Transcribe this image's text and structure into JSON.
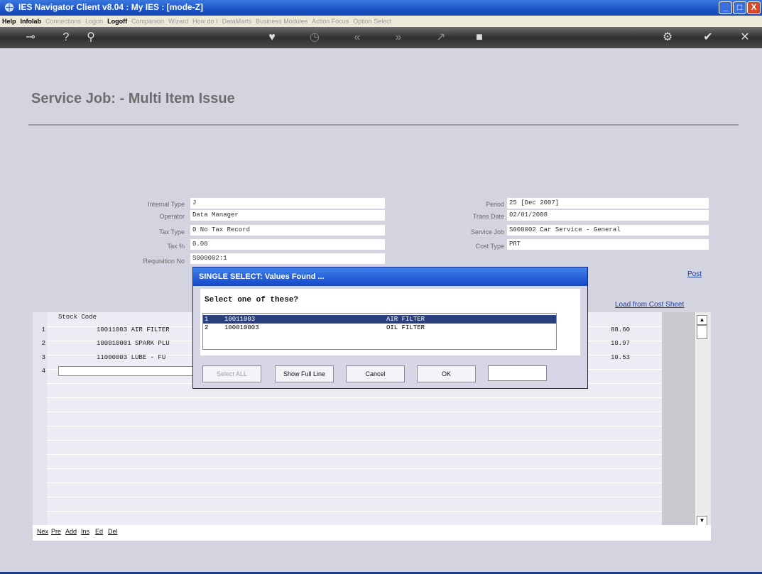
{
  "window": {
    "title": "IES Navigator Client v8.04 : My IES :      [mode-Z]",
    "min": "_",
    "max": "□",
    "close": "X"
  },
  "menu": [
    {
      "label": "Help",
      "active": true
    },
    {
      "label": "Infolab",
      "active": true
    },
    {
      "label": "Connections",
      "active": false
    },
    {
      "label": "Logon",
      "active": false
    },
    {
      "label": "Logoff",
      "active": true
    },
    {
      "label": "Companion",
      "active": false
    },
    {
      "label": "Wizard",
      "active": false
    },
    {
      "label": "How do I",
      "active": false
    },
    {
      "label": "DataMarts",
      "active": false
    },
    {
      "label": "Business Modules",
      "active": false
    },
    {
      "label": "Action Focus",
      "active": false
    },
    {
      "label": "Option Select",
      "active": false
    }
  ],
  "toolbar_icons": [
    "key-icon",
    "help-icon",
    "search-icon",
    "heart-icon",
    "clock-icon",
    "rewind-icon",
    "fast-forward-icon",
    "exit-icon",
    "stop-icon",
    "settings-icon",
    "check-icon",
    "close-icon"
  ],
  "page": {
    "title": "Service Job: - Multi Item Issue",
    "fields_left": [
      {
        "label": "Internal Type",
        "value": "J"
      },
      {
        "label": "Operator",
        "value": "Data Manager"
      },
      {
        "label": "Tax Type",
        "value": "0 No Tax Record"
      },
      {
        "label": "Tax %",
        "value": "    0.00"
      },
      {
        "label": "Requisition No",
        "value": "S000002:1"
      }
    ],
    "fields_right": [
      {
        "label": "Period",
        "value": "25  [Dec 2007]"
      },
      {
        "label": "Trans Date",
        "value": "  02/01/2008"
      },
      {
        "label": "Service Job",
        "value": "S000002 Car Service - General"
      },
      {
        "label": "Cost Type",
        "value": "PRT"
      }
    ],
    "post_label": "Post",
    "load_label": "Load from Cost Sheet"
  },
  "grid": {
    "header": "Stock Code",
    "rows": [
      {
        "num": "1",
        "text": "10011003 AIR FILTER",
        "amount": "88.60"
      },
      {
        "num": "2",
        "text": "100010001 SPARK PLU",
        "amount": "10.97"
      },
      {
        "num": "3",
        "text": "11000003 LUBE - FU",
        "amount": "10.53"
      },
      {
        "num": "4",
        "text": "",
        "amount": ""
      }
    ]
  },
  "bottom_nav": [
    "Nex",
    "Pre",
    "Add",
    "Ins",
    "Ed",
    "Del"
  ],
  "dialog": {
    "title": "SINGLE SELECT: Values Found ...",
    "prompt": "Select one of these?",
    "options": [
      {
        "num": "1",
        "code": "10011003",
        "desc": "AIR FILTER",
        "selected": true
      },
      {
        "num": "2",
        "code": "100010003",
        "desc": "OIL FILTER",
        "selected": false
      }
    ],
    "buttons": {
      "select_all": "Select ALL",
      "show_full": "Show Full Line",
      "cancel": "Cancel",
      "ok": "OK"
    }
  }
}
